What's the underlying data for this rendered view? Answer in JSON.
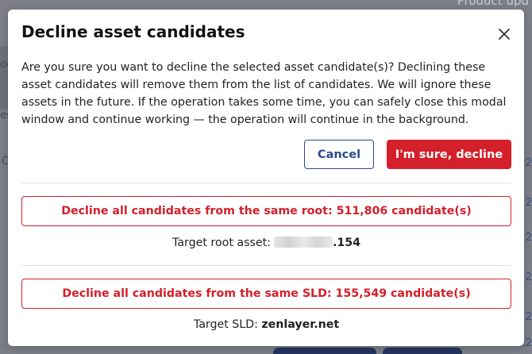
{
  "background": {
    "header_fragment": "Product upd",
    "left_fragments": [
      "oo",
      "es",
      "C"
    ],
    "right_fragments": [
      "22",
      "2",
      "2",
      "22",
      "22",
      "22"
    ]
  },
  "modal": {
    "title": "Decline asset candidates",
    "close_icon": "close-icon",
    "message": "Are you sure you want to decline the selected asset candidate(s)? Declining these asset candidates will remove them from the list of candidates. We will ignore these assets in the future. If the operation takes some time, you can safely close this modal window and continue working — the operation will continue in the background.",
    "cancel_label": "Cancel",
    "confirm_label": "I'm sure, decline",
    "root_option": {
      "button_label": "Decline all candidates from the same root: 511,806 candidate(s)",
      "target_label": "Target root asset:",
      "target_value": ".154"
    },
    "sld_option": {
      "button_label": "Decline all candidates from the same SLD: 155,549 candidate(s)",
      "target_label": "Target SLD:",
      "target_value": "zenlayer.net"
    }
  },
  "colors": {
    "primary_blue": "#2c4a86",
    "danger_red": "#d3202b",
    "backdrop": "#7c7f88"
  }
}
